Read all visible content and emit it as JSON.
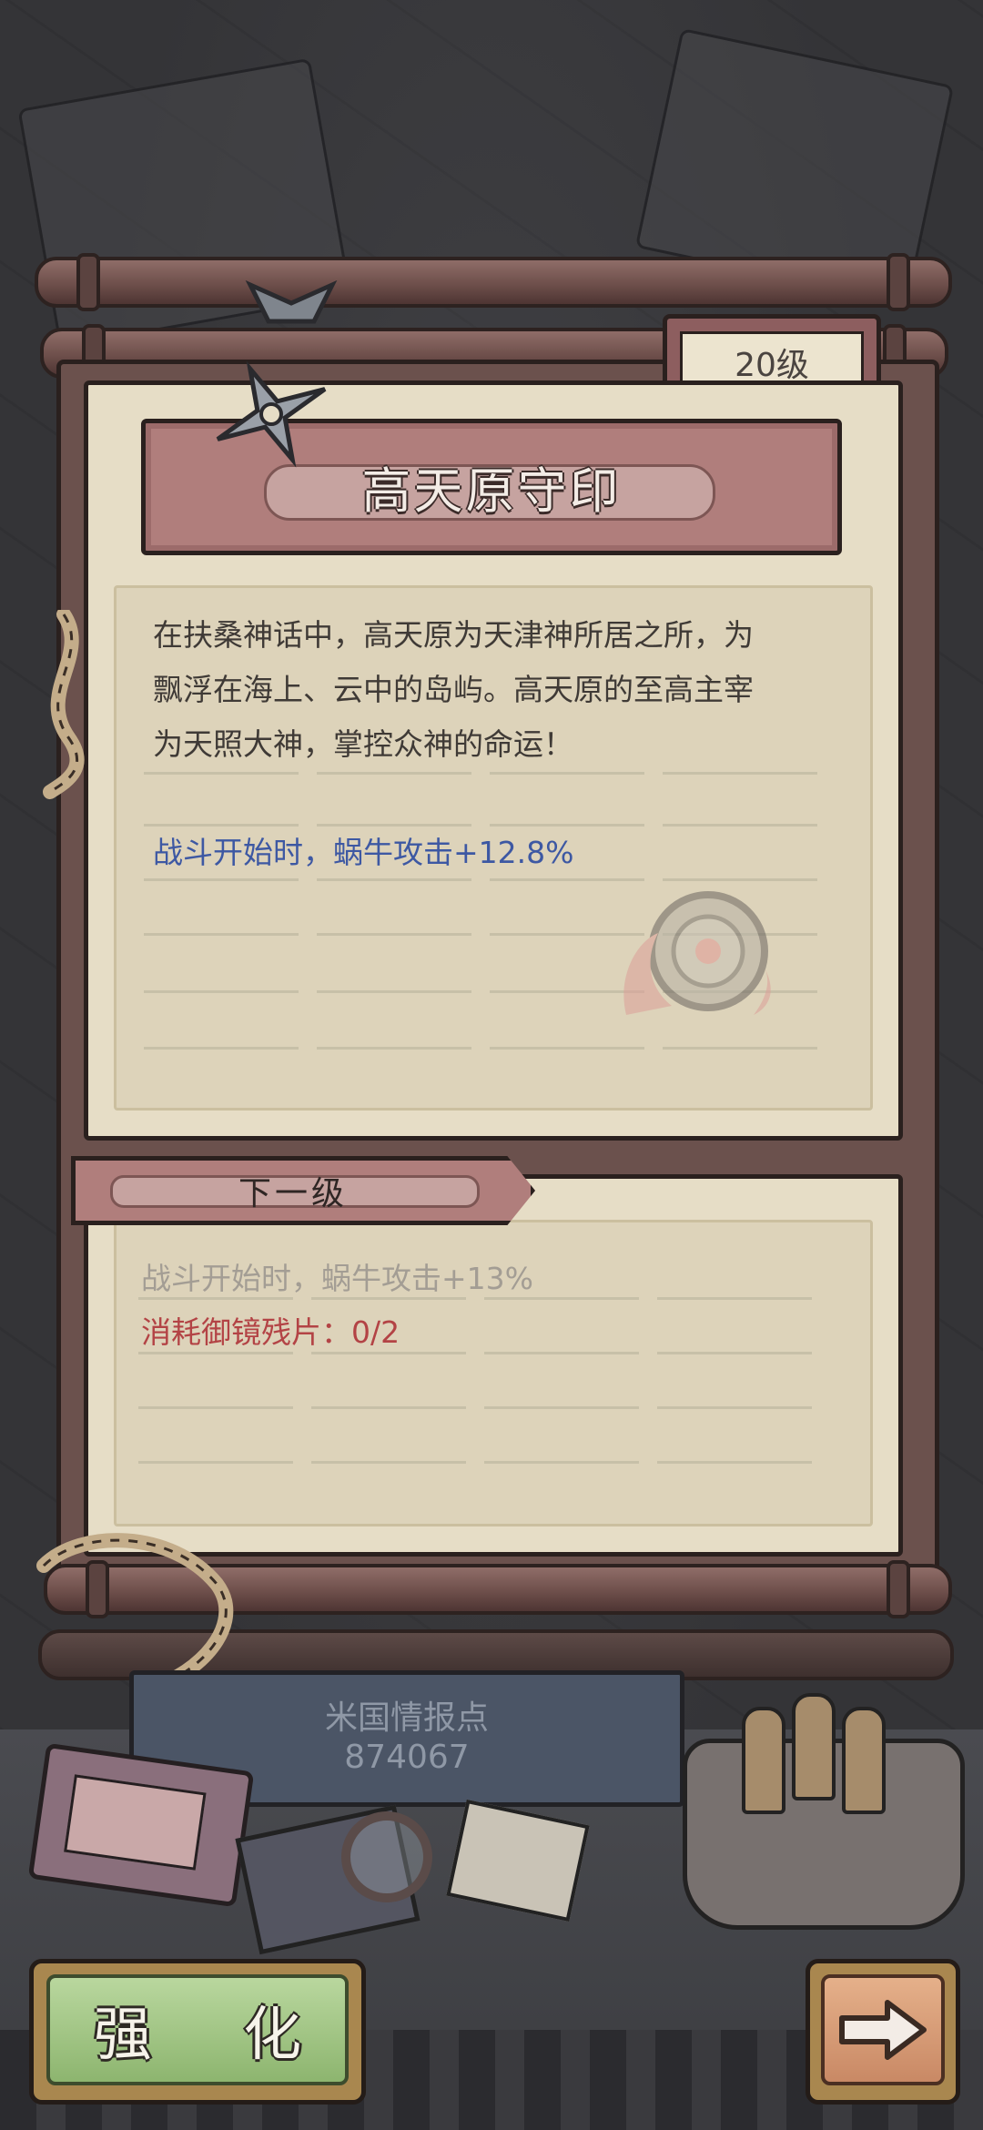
{
  "item": {
    "level": "20级",
    "name": "高天原守印",
    "description_lines": [
      "在扶桑神话中，高天原为天津神所居之所，为",
      "飘浮在海上、云中的岛屿。高天原的至高主宰",
      "为天照大神，掌控众神的命运！"
    ],
    "current_effect": "战斗开始时，蜗牛攻击+12.8%"
  },
  "next_level": {
    "header": "下一级",
    "effect": "战斗开始时，蜗牛攻击+13%",
    "cost": "消耗御镜残片：0/2"
  },
  "intel": {
    "label": "米国情报点",
    "value": "874067"
  },
  "buttons": {
    "strengthen": "强 化",
    "next_icon": "arrow-right-icon"
  },
  "colors": {
    "effect_blue": "#3d58a3",
    "cost_red": "#b34345",
    "button_green": "#9ac47d",
    "button_orange": "#d99b74"
  }
}
